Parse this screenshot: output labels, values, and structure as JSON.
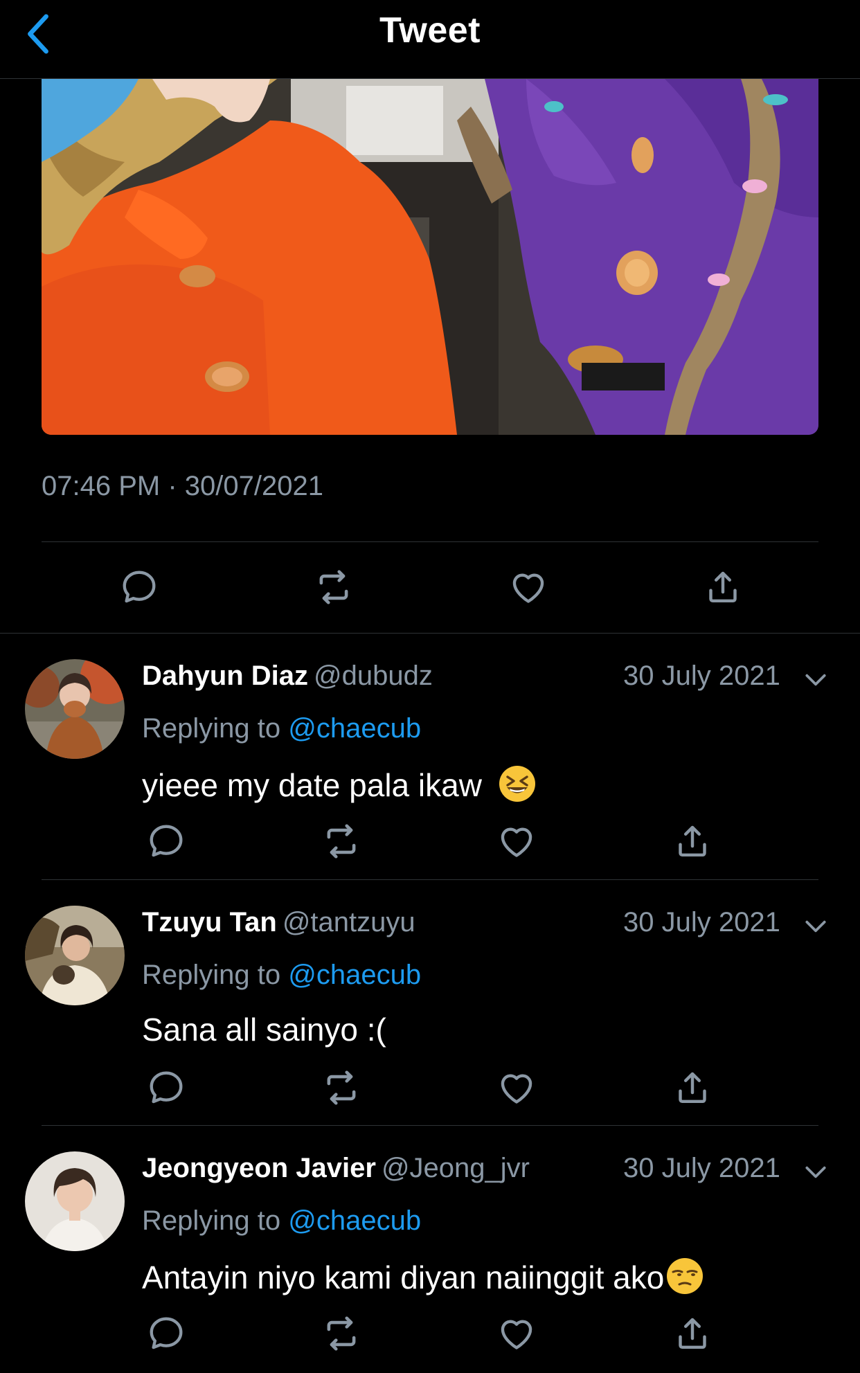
{
  "header": {
    "title": "Tweet",
    "back_icon": "chevron-left-icon",
    "accent": "#1d9bf0"
  },
  "tweet": {
    "timestamp": "07:46 PM · 30/07/2021",
    "actions": [
      "reply-icon",
      "retweet-icon",
      "like-icon",
      "share-icon"
    ]
  },
  "colors": {
    "background": "#000000",
    "secondary_text": "#8b98a5",
    "mention": "#1d9bf0",
    "divider": "#2f3336"
  },
  "replies": [
    {
      "display_name": "Dahyun Diaz",
      "handle": "@dubudz",
      "date": "30 July 2021",
      "replying_prefix": "Replying to",
      "replying_to": "@chaecub",
      "text": "yieee my date pala ikaw",
      "emoji": "grinning-squinting-face"
    },
    {
      "display_name": "Tzuyu Tan",
      "handle": "@tantzuyu",
      "date": "30 July 2021",
      "replying_prefix": "Replying to",
      "replying_to": "@chaecub",
      "text": "Sana all sainyo :(",
      "emoji": ""
    },
    {
      "display_name": "Jeongyeon Javier",
      "handle": "@Jeong_jvr",
      "date": "30 July 2021",
      "replying_prefix": "Replying to",
      "replying_to": "@chaecub",
      "text": "Antayin niyo kami diyan naiinggit ako",
      "emoji": "unamused-face"
    }
  ]
}
